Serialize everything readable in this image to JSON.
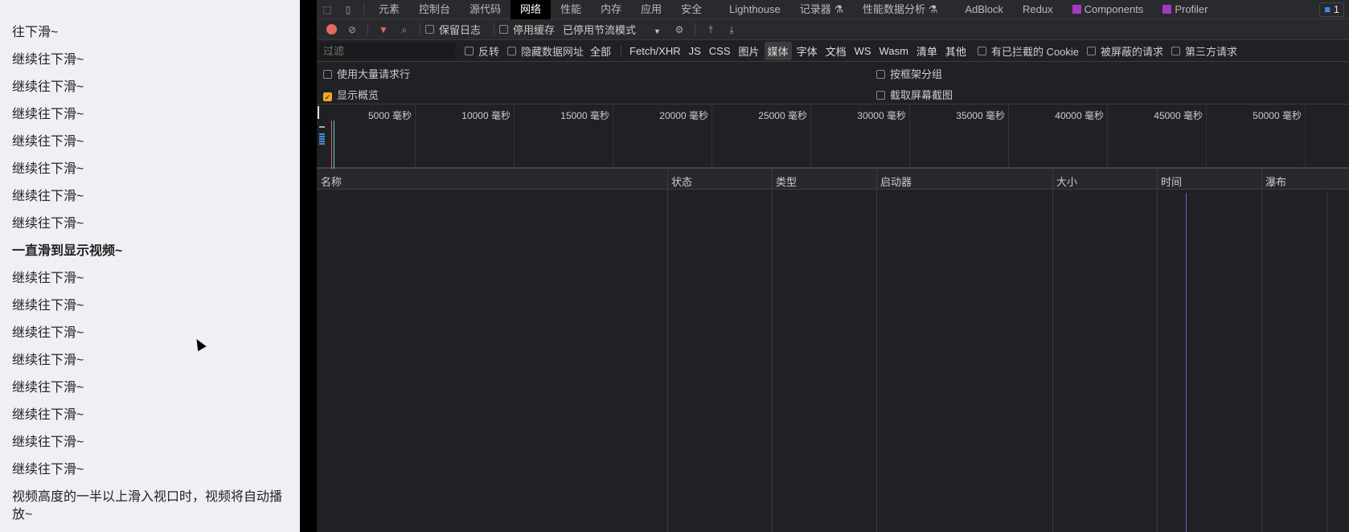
{
  "page": {
    "lines": [
      "往下滑~",
      "继续往下滑~",
      "继续往下滑~",
      "继续往下滑~",
      "继续往下滑~",
      "继续往下滑~",
      "继续往下滑~",
      "继续往下滑~",
      "一直滑到显示视频~",
      "继续往下滑~",
      "继续往下滑~",
      "继续往下滑~",
      "继续往下滑~",
      "继续往下滑~",
      "继续往下滑~",
      "继续往下滑~",
      "继续往下滑~",
      "视频高度的一半以上滑入视口时，视频将自动播放~"
    ]
  },
  "devtools": {
    "tabs": [
      "元素",
      "控制台",
      "源代码",
      "网络",
      "性能",
      "内存",
      "应用",
      "安全",
      "Lighthouse",
      "记录器 ⚗",
      "性能数据分析 ⚗",
      "AdBlock",
      "Redux",
      "Components",
      "Profiler"
    ],
    "active_tab": "网络",
    "issues_count": "1",
    "toolbar": {
      "preserve_log": "保留日志",
      "disable_cache": "停用缓存",
      "throttling": "已停用节流模式"
    },
    "filter": {
      "placeholder": "过滤",
      "invert": "反转",
      "hide_data_urls": "隐藏数据网址",
      "types": [
        "全部",
        "Fetch/XHR",
        "JS",
        "CSS",
        "图片",
        "媒体",
        "字体",
        "文档",
        "WS",
        "Wasm",
        "清单",
        "其他"
      ],
      "selected_type": "媒体",
      "blocked_cookies": "有已拦截的 Cookie",
      "blocked_requests": "被屏蔽的请求",
      "third_party": "第三方请求"
    },
    "options": {
      "big_rows": "使用大量请求行",
      "group_by_frame": "按框架分组",
      "show_overview": "显示概览",
      "capture_screenshots": "截取屏幕截图",
      "show_overview_checked": true
    },
    "timeline_ticks": [
      "5000 毫秒",
      "10000 毫秒",
      "15000 毫秒",
      "20000 毫秒",
      "25000 毫秒",
      "30000 毫秒",
      "35000 毫秒",
      "40000 毫秒",
      "45000 毫秒",
      "50000 毫秒"
    ],
    "columns": [
      "名称",
      "状态",
      "类型",
      "启动器",
      "大小",
      "时间",
      "瀑布"
    ]
  }
}
